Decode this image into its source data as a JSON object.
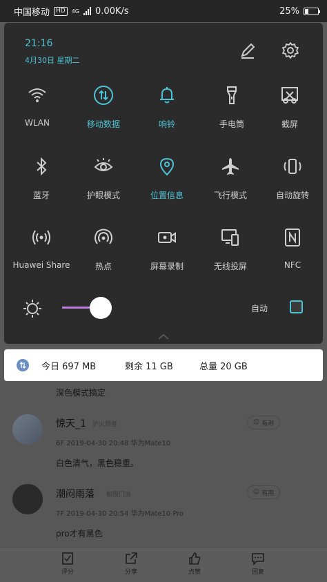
{
  "status_bar": {
    "carrier": "中国移动",
    "hd": "HD",
    "net": "4G",
    "speed": "0.00K/s",
    "battery": "25%",
    "battery_level": 0.25
  },
  "shade": {
    "time": "21:16",
    "date": "4月30日 星期二",
    "tiles": [
      {
        "label": "WLAN",
        "icon": "wifi-icon",
        "active": false
      },
      {
        "label": "移动数据",
        "icon": "mobile-data-icon",
        "active": true
      },
      {
        "label": "响铃",
        "icon": "bell-icon",
        "active": true
      },
      {
        "label": "手电筒",
        "icon": "flashlight-icon",
        "active": false
      },
      {
        "label": "截屏",
        "icon": "screenshot-icon",
        "active": false
      },
      {
        "label": "蓝牙",
        "icon": "bluetooth-icon",
        "active": false
      },
      {
        "label": "护眼模式",
        "icon": "eye-icon",
        "active": false
      },
      {
        "label": "位置信息",
        "icon": "location-icon",
        "active": true
      },
      {
        "label": "飞行模式",
        "icon": "airplane-icon",
        "active": false
      },
      {
        "label": "自动旋转",
        "icon": "rotate-icon",
        "active": false
      },
      {
        "label": "Huawei Share",
        "icon": "huawei-share-icon",
        "active": false
      },
      {
        "label": "热点",
        "icon": "hotspot-icon",
        "active": false
      },
      {
        "label": "屏幕录制",
        "icon": "screen-record-icon",
        "active": false
      },
      {
        "label": "无线投屏",
        "icon": "cast-icon",
        "active": false
      },
      {
        "label": "NFC",
        "icon": "nfc-icon",
        "active": false
      }
    ],
    "brightness": {
      "level": 0.15,
      "auto_label": "自动"
    }
  },
  "usage": {
    "today": "今日 697 MB",
    "remaining": "剩余 11 GB",
    "total": "总量 20 GB"
  },
  "background": {
    "snippet": "深色模式搞定",
    "comments": [
      {
        "name": "惊天_1",
        "tag": "护火预者",
        "meta": "6F   2019-04-30 20:48   华为Mate10",
        "text": "白色清气，黑色稳重。",
        "like": "有用"
      },
      {
        "name": "潮闷雨落",
        "tag": "都原门派",
        "meta": "7F   2019-04-30 20:54   华为Mate10 Pro",
        "text": "pro才有黑色",
        "like": "有用"
      }
    ],
    "bottom_bar": [
      {
        "label": "评分",
        "icon": "rate-icon"
      },
      {
        "label": "分享",
        "icon": "share-icon"
      },
      {
        "label": "点赞",
        "icon": "thumbs-up-icon"
      },
      {
        "label": "回复",
        "icon": "reply-icon"
      }
    ]
  }
}
